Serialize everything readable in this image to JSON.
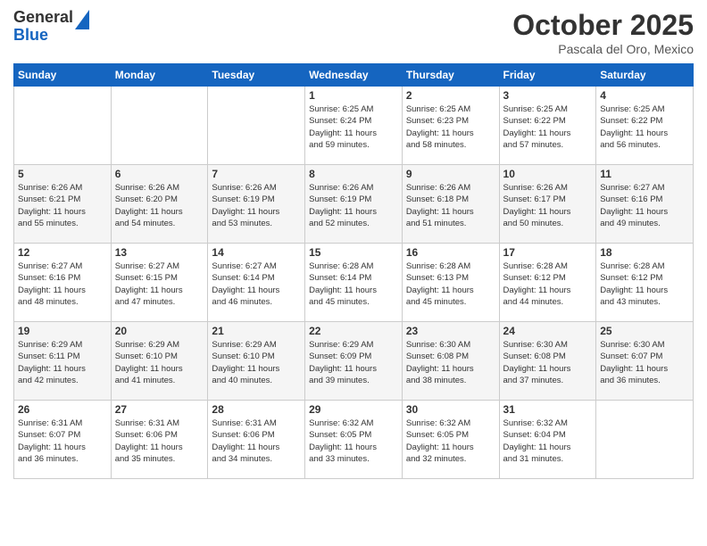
{
  "logo": {
    "general": "General",
    "blue": "Blue"
  },
  "header": {
    "month": "October 2025",
    "location": "Pascala del Oro, Mexico"
  },
  "weekdays": [
    "Sunday",
    "Monday",
    "Tuesday",
    "Wednesday",
    "Thursday",
    "Friday",
    "Saturday"
  ],
  "weeks": [
    [
      {
        "day": "",
        "info": ""
      },
      {
        "day": "",
        "info": ""
      },
      {
        "day": "",
        "info": ""
      },
      {
        "day": "1",
        "info": "Sunrise: 6:25 AM\nSunset: 6:24 PM\nDaylight: 11 hours\nand 59 minutes."
      },
      {
        "day": "2",
        "info": "Sunrise: 6:25 AM\nSunset: 6:23 PM\nDaylight: 11 hours\nand 58 minutes."
      },
      {
        "day": "3",
        "info": "Sunrise: 6:25 AM\nSunset: 6:22 PM\nDaylight: 11 hours\nand 57 minutes."
      },
      {
        "day": "4",
        "info": "Sunrise: 6:25 AM\nSunset: 6:22 PM\nDaylight: 11 hours\nand 56 minutes."
      }
    ],
    [
      {
        "day": "5",
        "info": "Sunrise: 6:26 AM\nSunset: 6:21 PM\nDaylight: 11 hours\nand 55 minutes."
      },
      {
        "day": "6",
        "info": "Sunrise: 6:26 AM\nSunset: 6:20 PM\nDaylight: 11 hours\nand 54 minutes."
      },
      {
        "day": "7",
        "info": "Sunrise: 6:26 AM\nSunset: 6:19 PM\nDaylight: 11 hours\nand 53 minutes."
      },
      {
        "day": "8",
        "info": "Sunrise: 6:26 AM\nSunset: 6:19 PM\nDaylight: 11 hours\nand 52 minutes."
      },
      {
        "day": "9",
        "info": "Sunrise: 6:26 AM\nSunset: 6:18 PM\nDaylight: 11 hours\nand 51 minutes."
      },
      {
        "day": "10",
        "info": "Sunrise: 6:26 AM\nSunset: 6:17 PM\nDaylight: 11 hours\nand 50 minutes."
      },
      {
        "day": "11",
        "info": "Sunrise: 6:27 AM\nSunset: 6:16 PM\nDaylight: 11 hours\nand 49 minutes."
      }
    ],
    [
      {
        "day": "12",
        "info": "Sunrise: 6:27 AM\nSunset: 6:16 PM\nDaylight: 11 hours\nand 48 minutes."
      },
      {
        "day": "13",
        "info": "Sunrise: 6:27 AM\nSunset: 6:15 PM\nDaylight: 11 hours\nand 47 minutes."
      },
      {
        "day": "14",
        "info": "Sunrise: 6:27 AM\nSunset: 6:14 PM\nDaylight: 11 hours\nand 46 minutes."
      },
      {
        "day": "15",
        "info": "Sunrise: 6:28 AM\nSunset: 6:14 PM\nDaylight: 11 hours\nand 45 minutes."
      },
      {
        "day": "16",
        "info": "Sunrise: 6:28 AM\nSunset: 6:13 PM\nDaylight: 11 hours\nand 45 minutes."
      },
      {
        "day": "17",
        "info": "Sunrise: 6:28 AM\nSunset: 6:12 PM\nDaylight: 11 hours\nand 44 minutes."
      },
      {
        "day": "18",
        "info": "Sunrise: 6:28 AM\nSunset: 6:12 PM\nDaylight: 11 hours\nand 43 minutes."
      }
    ],
    [
      {
        "day": "19",
        "info": "Sunrise: 6:29 AM\nSunset: 6:11 PM\nDaylight: 11 hours\nand 42 minutes."
      },
      {
        "day": "20",
        "info": "Sunrise: 6:29 AM\nSunset: 6:10 PM\nDaylight: 11 hours\nand 41 minutes."
      },
      {
        "day": "21",
        "info": "Sunrise: 6:29 AM\nSunset: 6:10 PM\nDaylight: 11 hours\nand 40 minutes."
      },
      {
        "day": "22",
        "info": "Sunrise: 6:29 AM\nSunset: 6:09 PM\nDaylight: 11 hours\nand 39 minutes."
      },
      {
        "day": "23",
        "info": "Sunrise: 6:30 AM\nSunset: 6:08 PM\nDaylight: 11 hours\nand 38 minutes."
      },
      {
        "day": "24",
        "info": "Sunrise: 6:30 AM\nSunset: 6:08 PM\nDaylight: 11 hours\nand 37 minutes."
      },
      {
        "day": "25",
        "info": "Sunrise: 6:30 AM\nSunset: 6:07 PM\nDaylight: 11 hours\nand 36 minutes."
      }
    ],
    [
      {
        "day": "26",
        "info": "Sunrise: 6:31 AM\nSunset: 6:07 PM\nDaylight: 11 hours\nand 36 minutes."
      },
      {
        "day": "27",
        "info": "Sunrise: 6:31 AM\nSunset: 6:06 PM\nDaylight: 11 hours\nand 35 minutes."
      },
      {
        "day": "28",
        "info": "Sunrise: 6:31 AM\nSunset: 6:06 PM\nDaylight: 11 hours\nand 34 minutes."
      },
      {
        "day": "29",
        "info": "Sunrise: 6:32 AM\nSunset: 6:05 PM\nDaylight: 11 hours\nand 33 minutes."
      },
      {
        "day": "30",
        "info": "Sunrise: 6:32 AM\nSunset: 6:05 PM\nDaylight: 11 hours\nand 32 minutes."
      },
      {
        "day": "31",
        "info": "Sunrise: 6:32 AM\nSunset: 6:04 PM\nDaylight: 11 hours\nand 31 minutes."
      },
      {
        "day": "",
        "info": ""
      }
    ]
  ]
}
